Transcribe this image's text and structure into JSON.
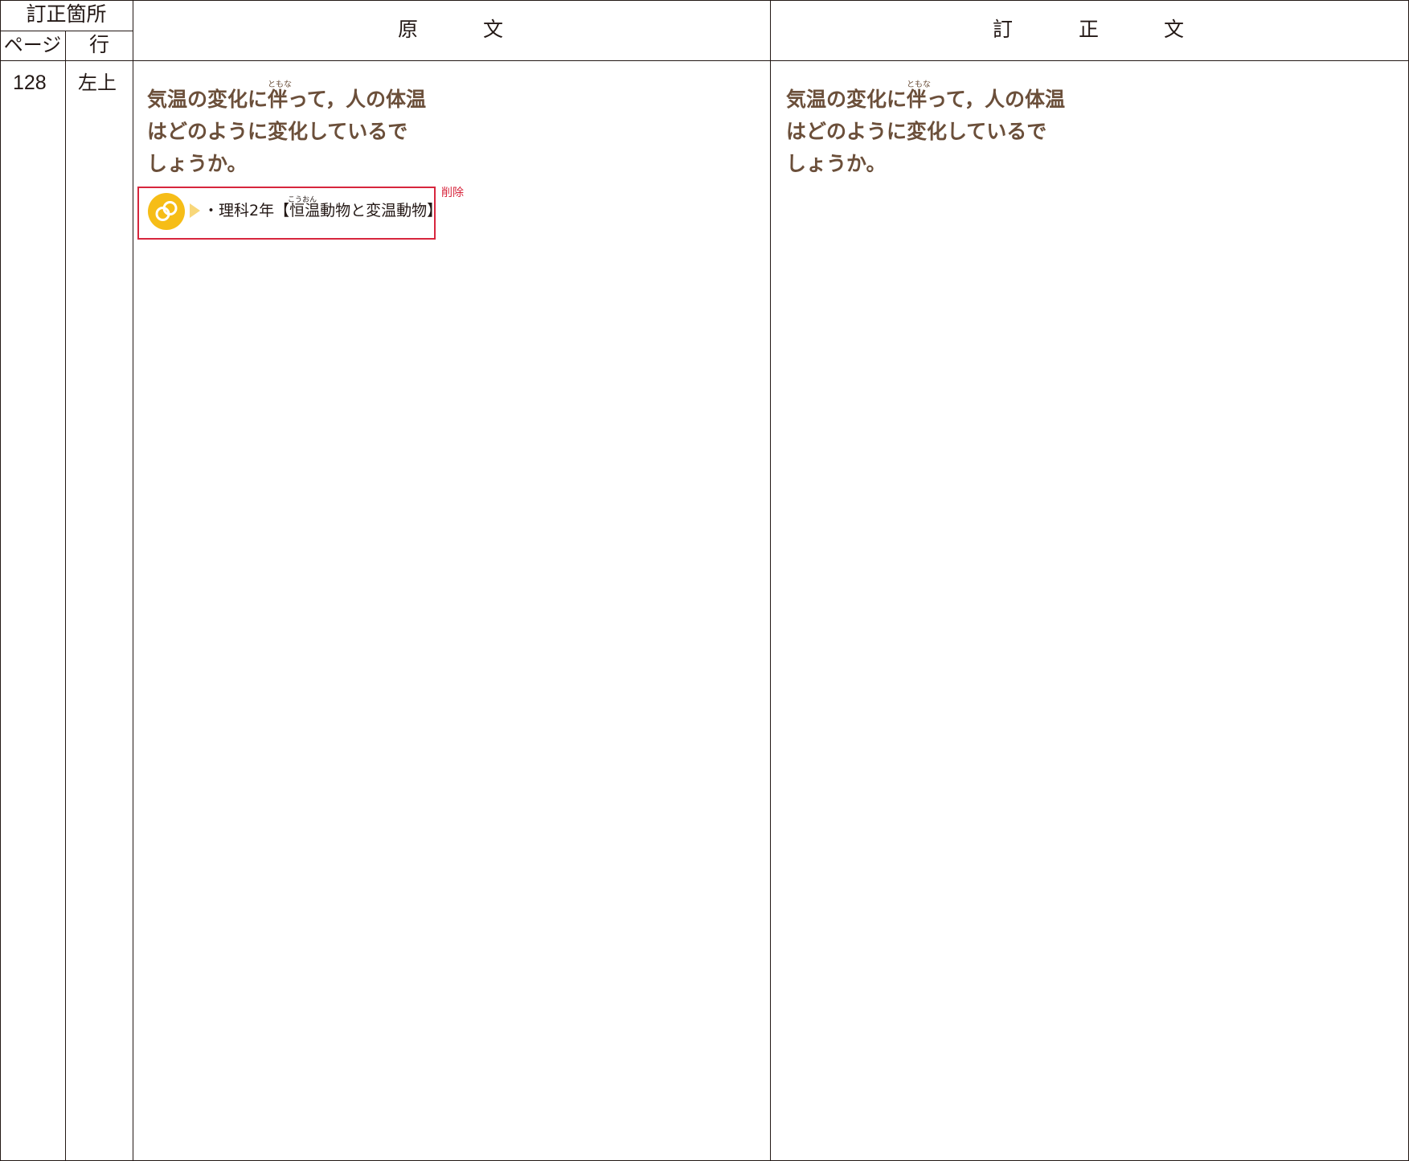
{
  "header": {
    "location_label": "訂正箇所",
    "page_label": "ページ",
    "line_label": "行",
    "original_label_chars": [
      "原",
      "文"
    ],
    "corrected_label_chars": [
      "訂",
      "正",
      "文"
    ]
  },
  "row": {
    "page": "128",
    "line": "左上",
    "original": {
      "question_lines": [
        "気温の変化に伴って，人の体温",
        "はどのように変化しているで",
        "しょうか。"
      ],
      "question_ruby": "ともな",
      "link_text": "・理科2年【恒温動物と変温動物】",
      "link_ruby": "こうおん",
      "link_icon": "link-icon",
      "delete_note": "削除"
    },
    "corrected": {
      "question_lines": [
        "気温の変化に伴って，人の体温",
        "はどのように変化しているで",
        "しょうか。"
      ],
      "question_ruby": "ともな"
    }
  },
  "colors": {
    "line": "#231815",
    "question_text": "#6b4f3a",
    "delete_red": "#d7263d",
    "icon_yellow": "#f6bd17",
    "arrow_yellow": "#f8d77a"
  }
}
